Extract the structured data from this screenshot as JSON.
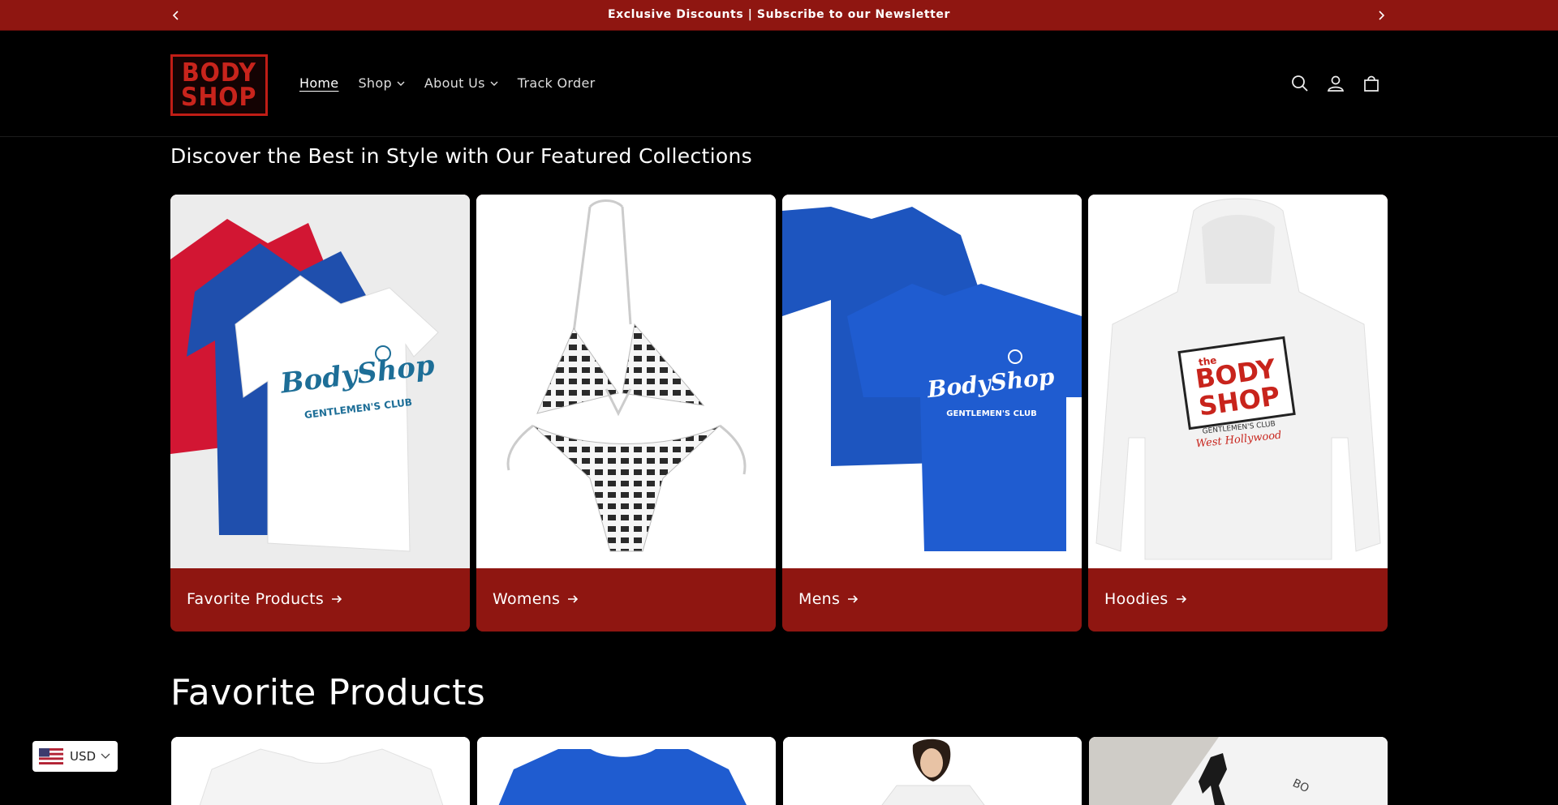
{
  "announcement": {
    "text": "Exclusive Discounts | Subscribe to our Newsletter"
  },
  "logo": {
    "line1": "BODY",
    "line2": "SHOP"
  },
  "nav": {
    "home": "Home",
    "shop": "Shop",
    "about": "About Us",
    "track": "Track Order"
  },
  "featured": {
    "title": "Discover the Best in Style with Our Featured Collections",
    "cards": [
      {
        "label": "Favorite Products"
      },
      {
        "label": "Womens"
      },
      {
        "label": "Mens"
      },
      {
        "label": "Hoodies"
      }
    ],
    "tee_brand": "BodyShop",
    "tee_sub": "GENTLEMEN'S CLUB",
    "hoodie_the": "the",
    "hoodie_l1": "BODY",
    "hoodie_l2": "SHOP",
    "hoodie_club": "GENTLEMEN'S CLUB",
    "hoodie_city": "West Hollywood"
  },
  "favorites": {
    "title": "Favorite Products"
  },
  "currency": {
    "code": "USD"
  },
  "colors": {
    "brand_red": "#8f1611",
    "background": "#000000"
  },
  "icons": [
    "chevron-left-icon",
    "chevron-right-icon",
    "search-icon",
    "account-icon",
    "cart-icon",
    "arrow-right-icon",
    "us-flag-icon"
  ]
}
